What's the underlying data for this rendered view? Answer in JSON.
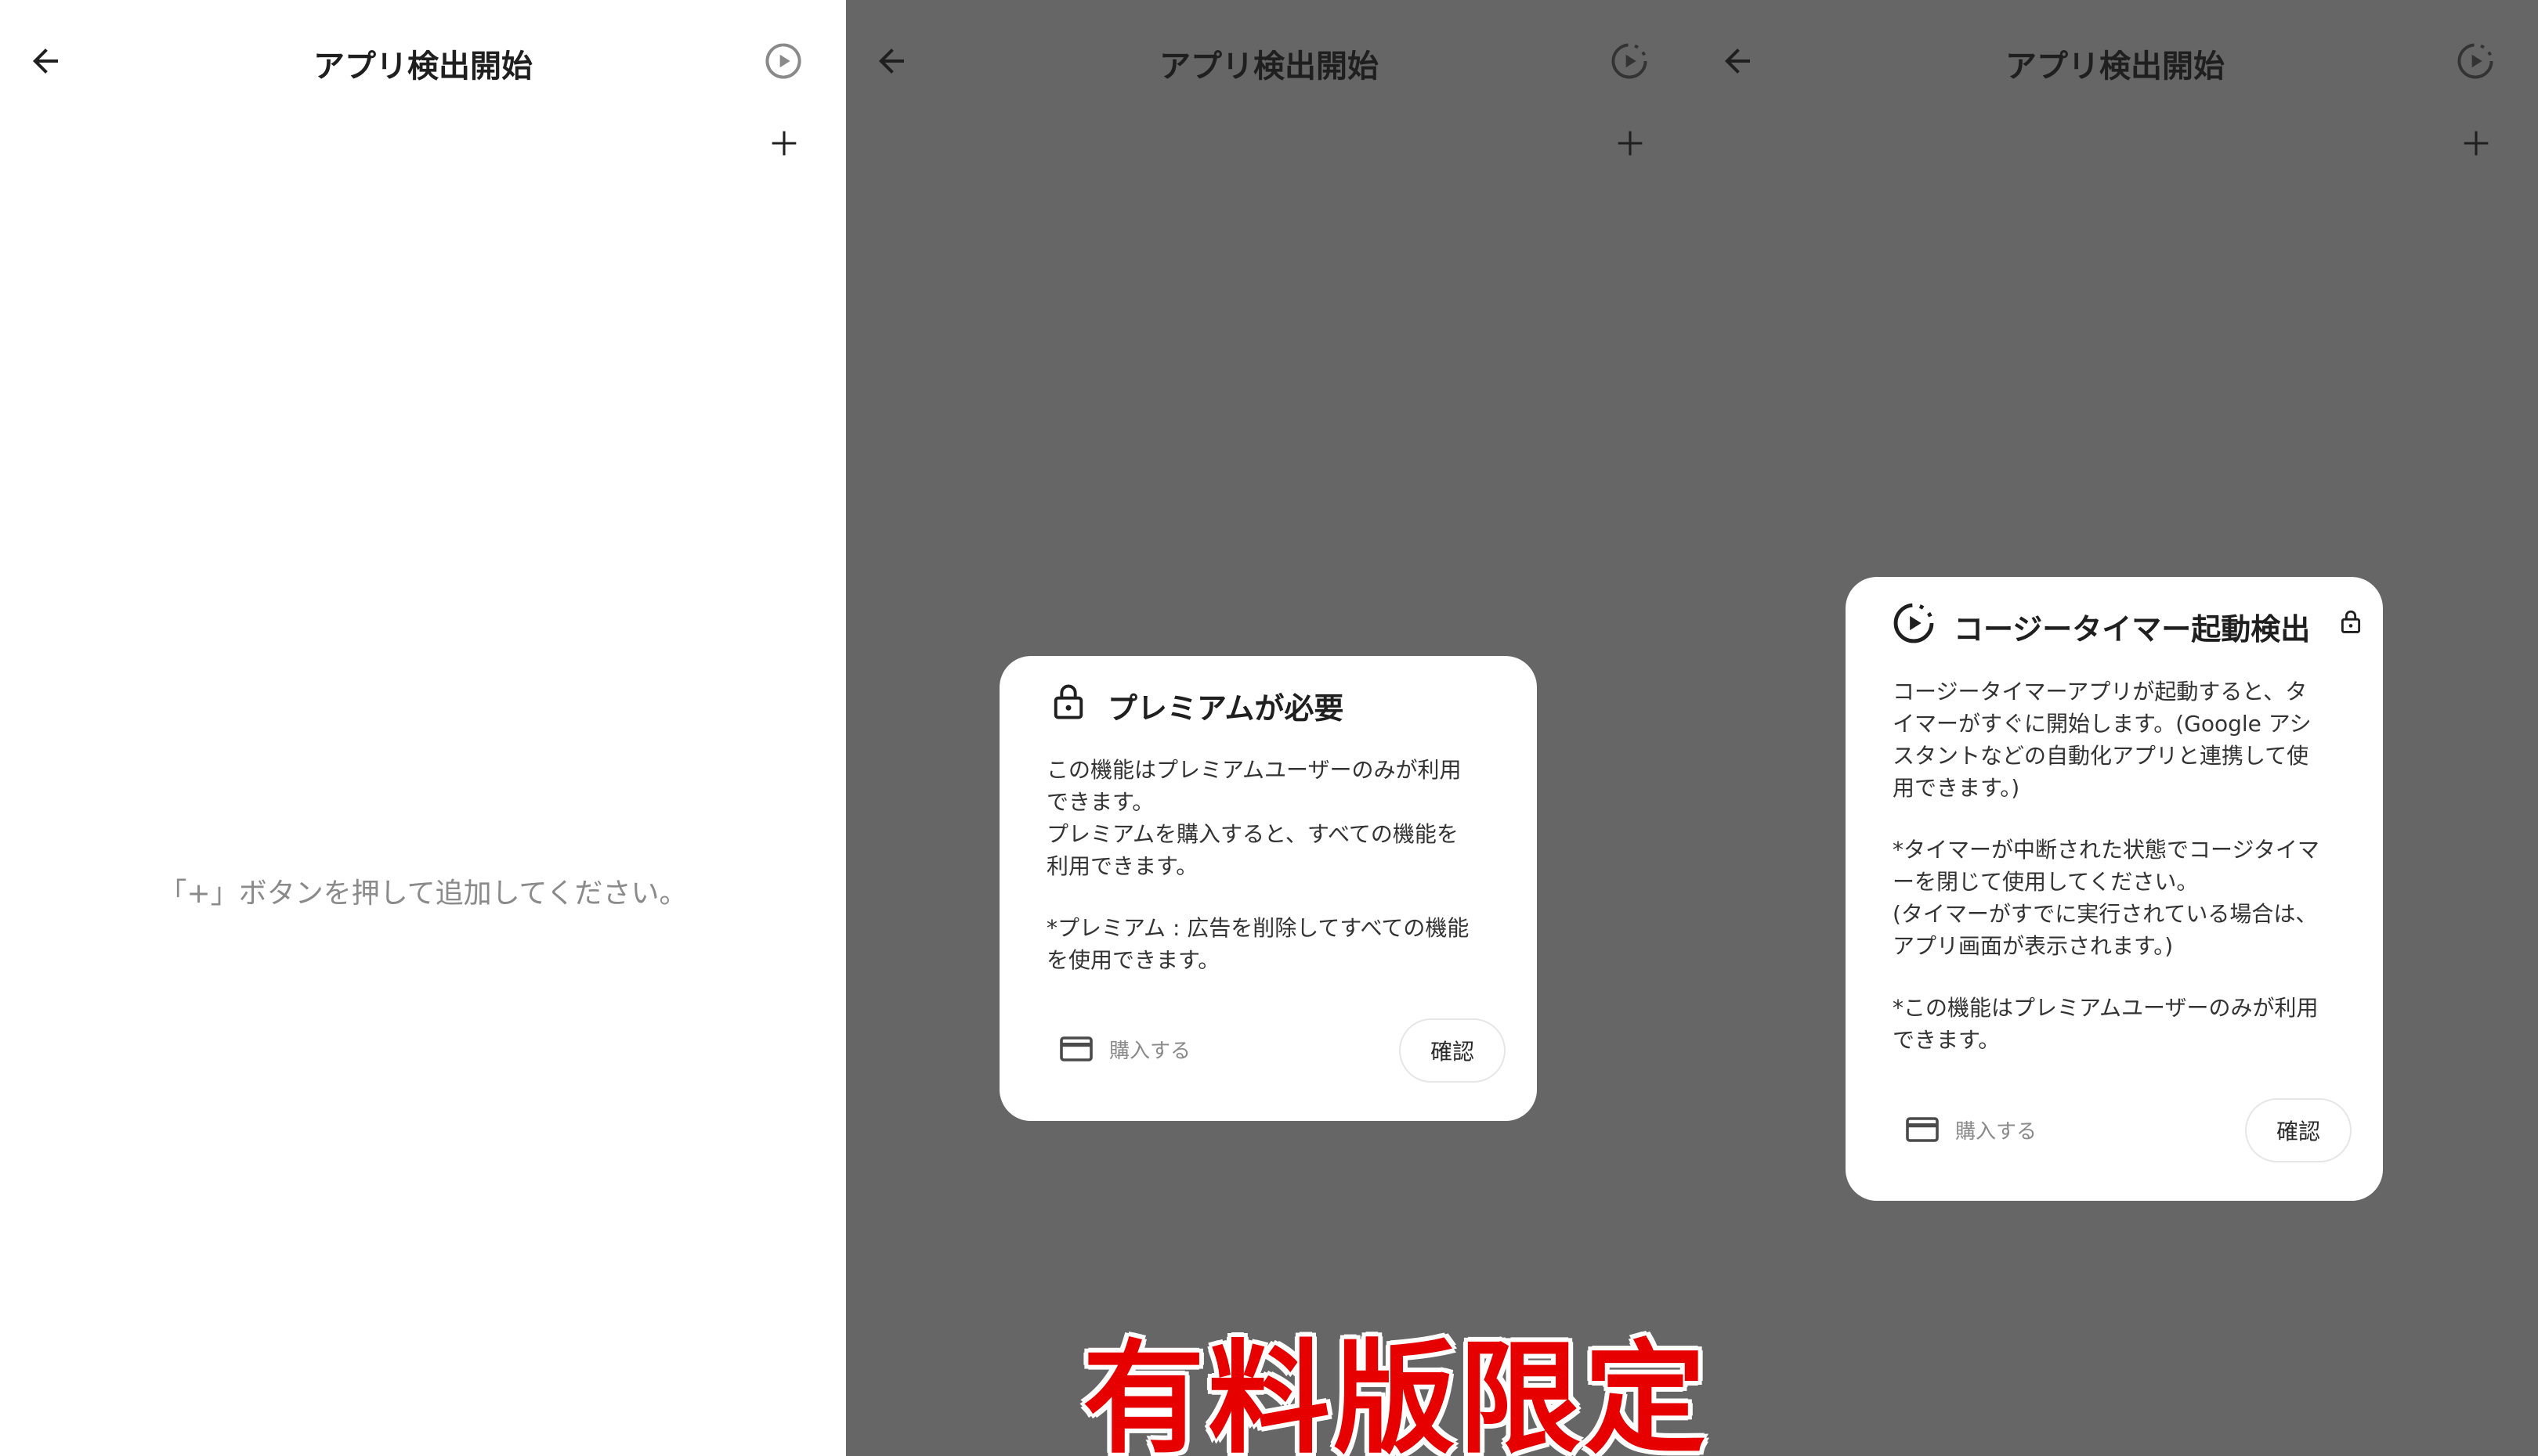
{
  "screens": [
    {
      "title": "アプリ検出開始",
      "empty_message": "「+」ボタンを押して追加してください。"
    },
    {
      "title": "アプリ検出開始",
      "dialog": {
        "icon": "lock-icon",
        "title": "プレミアムが必要",
        "body_lines_1": [
          "この機能はプレミアムユーザーのみが利用",
          "できます。",
          "プレミアムを購入すると、すべての機能を",
          "利用できます。"
        ],
        "body_lines_2": [
          "*プレミアム : 広告を削除してすべての機能",
          "を使用できます。"
        ],
        "buy_label": "購入する",
        "confirm_label": "確認"
      }
    },
    {
      "title": "アプリ検出開始",
      "dialog": {
        "icon": "timer-play-icon",
        "title": "コージータイマー起動検出",
        "body_lines_1": [
          "コージータイマーアプリが起動すると、タ",
          "イマーがすぐに開始します。(Google アシ",
          "スタントなどの自動化アプリと連携して使",
          "用できます。)"
        ],
        "body_lines_2": [
          "*タイマーが中断された状態でコージタイマ",
          "ーを閉じて使用してください。",
          "(タイマーがすでに実行されている場合は、",
          "アプリ画面が表示されます。)"
        ],
        "body_lines_3": [
          "*この機能はプレミアムユーザーのみが利用",
          "できます。"
        ],
        "buy_label": "購入する",
        "confirm_label": "確認"
      }
    }
  ],
  "annotation": {
    "text": "有料版限定",
    "color": "#e60000"
  },
  "colors": {
    "scrim": "#666666",
    "surface": "#ffffff",
    "annotation_red": "#e60000"
  }
}
